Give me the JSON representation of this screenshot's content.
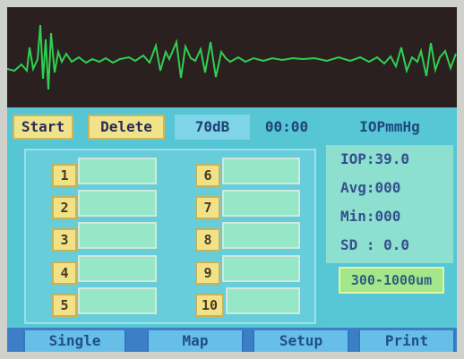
{
  "toolbar": {
    "start_label": "Start",
    "delete_label": "Delete",
    "gain_value": "70dB",
    "time_value": "00:00"
  },
  "right_panel": {
    "unit_label": "IOPmmHg",
    "iop": "IOP:39.0",
    "avg": "Avg:000",
    "min": "Min:000",
    "sd": "SD : 0.0",
    "range_label": "300-1000um"
  },
  "slots": {
    "left": [
      "1",
      "2",
      "3",
      "4",
      "5"
    ],
    "right": [
      "6",
      "7",
      "8",
      "9",
      "10"
    ]
  },
  "tabs": [
    "Single",
    "Map",
    "Setup",
    "Print"
  ],
  "colors": {
    "waveform": "#2fcf51",
    "screen_bg": "#2b2020",
    "panel_bg": "#56c5d4",
    "button_yellow": "#f0e38a",
    "field_green": "#96e6c8",
    "tab_blue": "#67bfe7"
  }
}
